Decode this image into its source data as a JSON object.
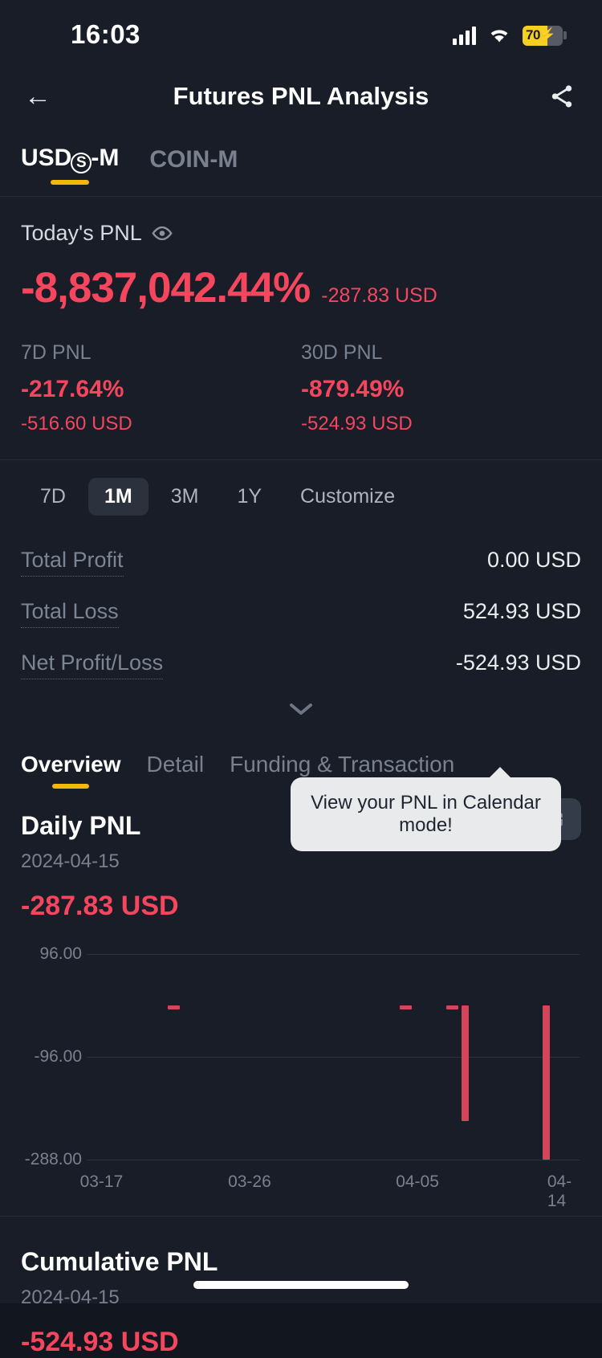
{
  "status_bar": {
    "time": "16:03",
    "battery_percent": "70",
    "battery_icon": "battery-charging-icon",
    "wifi_icon": "wifi-icon",
    "signal_icon": "cellular-signal-icon"
  },
  "nav": {
    "back_icon": "back-arrow-icon",
    "title": "Futures PNL Analysis",
    "share_icon": "share-icon"
  },
  "market_tabs": [
    {
      "label_prefix": "USD",
      "label_circle": "S",
      "label_suffix": "-M",
      "active": true
    },
    {
      "label": "COIN-M",
      "active": false
    }
  ],
  "todays_pnl": {
    "label": "Today's PNL",
    "eye_icon": "eye-icon",
    "percent": "-8,837,042.44%",
    "usd": "-287.83 USD",
    "columns": [
      {
        "title": "7D PNL",
        "percent": "-217.64%",
        "usd": "-516.60 USD"
      },
      {
        "title": "30D PNL",
        "percent": "-879.49%",
        "usd": "-524.93 USD"
      }
    ]
  },
  "range_filters": [
    {
      "label": "7D",
      "active": false
    },
    {
      "label": "1M",
      "active": true
    },
    {
      "label": "3M",
      "active": false
    },
    {
      "label": "1Y",
      "active": false
    },
    {
      "label": "Customize",
      "active": false
    }
  ],
  "summary": {
    "rows": [
      {
        "label": "Total Profit",
        "value": "0.00 USD"
      },
      {
        "label": "Total Loss",
        "value": "524.93 USD"
      },
      {
        "label": "Net Profit/Loss",
        "value": "-524.93 USD"
      }
    ],
    "expand_icon": "chevron-down-icon"
  },
  "content_tabs": [
    {
      "label": "Overview",
      "active": true
    },
    {
      "label": "Detail",
      "active": false
    },
    {
      "label": "Funding & Transaction",
      "active": false
    }
  ],
  "daily_pnl": {
    "title": "Daily PNL",
    "date": "2024-04-15",
    "amount": "-287.83 USD",
    "view_toggle": [
      {
        "icon": "bar-chart-icon",
        "selected": true
      },
      {
        "icon": "calendar-icon",
        "selected": false
      }
    ],
    "tooltip": "View your PNL in Calendar mode!"
  },
  "cumulative_pnl": {
    "title": "Cumulative PNL",
    "date": "2024-04-15",
    "amount": "-524.93 USD"
  },
  "colors": {
    "loss": "#f6465d",
    "bar": "#d4455a",
    "accent": "#f0b90b",
    "background": "#181d28"
  },
  "chart_data": {
    "type": "bar",
    "title": "Daily PNL",
    "xlabel": "",
    "ylabel": "",
    "ylim": [
      -288,
      96
    ],
    "yticks": [
      96.0,
      -96.0,
      -288.0
    ],
    "ytick_labels": [
      "96.00",
      "-96.00",
      "-288.00"
    ],
    "xtick_labels": [
      "03-17",
      "03-26",
      "04-05",
      "04-14"
    ],
    "xtick_positions_pct": [
      3,
      33,
      67,
      97
    ],
    "grid": true,
    "legend": "none",
    "categories": [
      "03-17",
      "03-18",
      "03-19",
      "03-20",
      "03-21",
      "03-22",
      "03-23",
      "03-24",
      "03-25",
      "03-26",
      "03-27",
      "03-28",
      "03-29",
      "03-30",
      "03-31",
      "04-01",
      "04-02",
      "04-03",
      "04-04",
      "04-05",
      "04-06",
      "04-07",
      "04-08",
      "04-09",
      "04-10",
      "04-11",
      "04-12",
      "04-13",
      "04-14",
      "04-15"
    ],
    "values": [
      0,
      0,
      0,
      -2,
      0,
      0,
      0,
      0,
      0,
      0,
      0,
      0,
      0,
      0,
      0,
      0,
      0,
      0,
      0,
      0,
      -2,
      0,
      0,
      -2,
      0,
      -216,
      0,
      0,
      -288,
      0
    ],
    "bars": [
      {
        "x_pct": 16.5,
        "value": -2,
        "label": "03-20"
      },
      {
        "x_pct": 63.5,
        "value": -2,
        "label": "04-06"
      },
      {
        "x_pct": 73.0,
        "value": -2,
        "label": "04-09"
      },
      {
        "x_pct": 76.0,
        "value": -216,
        "label": "04-11"
      },
      {
        "x_pct": 92.5,
        "value": -288,
        "label": "04-14"
      }
    ]
  }
}
